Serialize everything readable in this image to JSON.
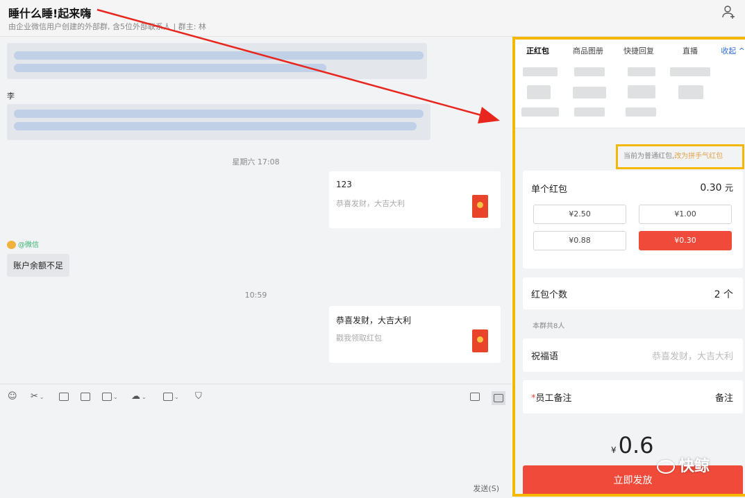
{
  "header": {
    "title": "睡什么睡!起来嗨",
    "subtitle": "由企业微信用户创建的外部群, 含5位外部联系人 | 群主: 林"
  },
  "chat": {
    "sender1": "李",
    "time1": "星期六 17:08",
    "redpacket1": {
      "amount": "123",
      "wish": "恭喜发财，大吉大利"
    },
    "wechat_label": "@微信",
    "balance_msg": "账户余额不足",
    "time2": "10:59",
    "redpacket2": {
      "amount": "恭喜发财，大吉大利",
      "wish": "戳我领取红包"
    }
  },
  "toolbar": {
    "send_label": "发送(S)"
  },
  "panel": {
    "tabs": [
      "正红包",
      "商品图册",
      "快捷回复",
      "直播"
    ],
    "collapse_label": "收起 ^",
    "notice_prefix": "当前为普通红包,",
    "notice_link": "改为拼手气红包",
    "single_label": "单个红包",
    "single_value": "0.30",
    "single_unit": "元",
    "amount_options": [
      "¥2.50",
      "¥1.00",
      "¥0.88",
      "¥0.30"
    ],
    "selected_amount": "¥0.30",
    "count_label": "红包个数",
    "count_value": "2",
    "count_unit": "个",
    "group_count": "本群共8人",
    "blessing_label": "祝福语",
    "blessing_placeholder": "恭喜发财，大吉大利",
    "note_star": "*",
    "note_label": "员工备注",
    "note_placeholder": "备注",
    "total_yen": "¥",
    "total_amount": "0.6",
    "submit_label": "立即发放"
  },
  "watermark": {
    "text": "快鲸"
  },
  "colors": {
    "accent_red": "#f04b3a",
    "highlight_frame": "#f5b800",
    "link_blue": "#2f6fe3",
    "arrow_red": "#e8261e"
  }
}
